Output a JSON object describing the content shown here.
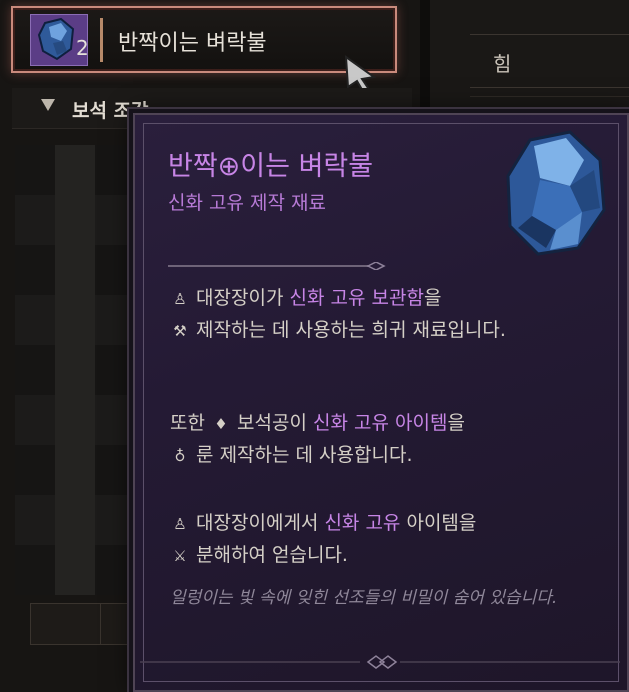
{
  "item_slot": {
    "count": "2",
    "name": "반짝이는 벼락불"
  },
  "category": {
    "label": "보석 조각"
  },
  "right_panel": {
    "stat_label": "힘"
  },
  "tooltip": {
    "title": "반짝⊕이는 벼락불",
    "subtitle": "신화 고유 제작 재료",
    "p1": {
      "npc": "대장장이",
      "mid1": "가 ",
      "hl1": "신화 고유 보관함",
      "mid2": "을",
      "action": "제작",
      "rest": "하는 데 사용하는 희귀 재료입니다."
    },
    "p2": {
      "pre": "또한 ",
      "npc": "보석공",
      "mid1": "이 ",
      "hl1": "신화 고유 아이템",
      "mid2": "을",
      "action": "룬 제작",
      "rest": "하는 데 사용합니다."
    },
    "p3": {
      "npc": "대장장이",
      "mid1": "에게서 ",
      "hl1": "신화 고유",
      "mid2": " 아이템을",
      "action": "분해",
      "rest": "하여 얻습니다."
    },
    "flavor": "일렁이는 빛 속에 잊힌 선조들의 비밀이 숨어 있습니다."
  },
  "icons": [
    "gem-icon",
    "cursor-icon",
    "anvil-icon",
    "hammer-icon",
    "diamond-icon",
    "rune-icon",
    "pick-icon"
  ],
  "colors": {
    "mythic": "#c785e6",
    "slot_border": "#c98a7c",
    "tooltip_bg": "#241a34"
  }
}
